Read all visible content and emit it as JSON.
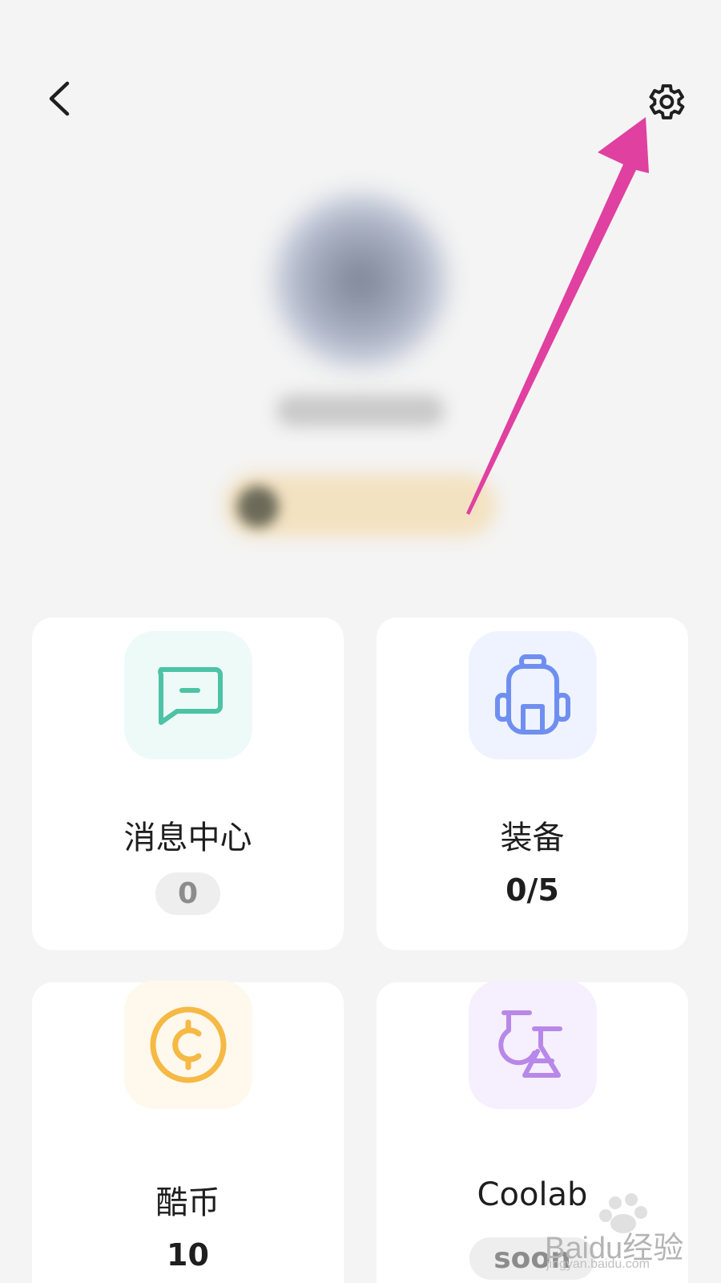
{
  "header": {
    "back_icon": "chevron-left-icon",
    "settings_icon": "gear-icon"
  },
  "profile": {
    "avatar": "blurred",
    "username": "",
    "level_badge": ""
  },
  "cards": [
    {
      "title": "消息中心",
      "value": "0",
      "icon": "message-bubble-icon",
      "icon_color": "#4cc3a5",
      "icon_bg": "#eefaf7"
    },
    {
      "title": "装备",
      "value": "0/5",
      "icon": "backpack-icon",
      "icon_color": "#6f8ff0",
      "icon_bg": "#eff3ff"
    },
    {
      "title": "酷币",
      "value": "10",
      "icon": "coin-icon",
      "icon_color": "#f5b944",
      "icon_bg": "#fff8ec"
    },
    {
      "title": "Coolab",
      "value": "soon",
      "icon": "flask-icon",
      "icon_color": "#b788e8",
      "icon_bg": "#f6effd"
    }
  ],
  "annotation": {
    "arrow_color": "#e040a0"
  },
  "watermark": {
    "text": "Baidu经验",
    "sub": "jingyan.baidu.com"
  }
}
